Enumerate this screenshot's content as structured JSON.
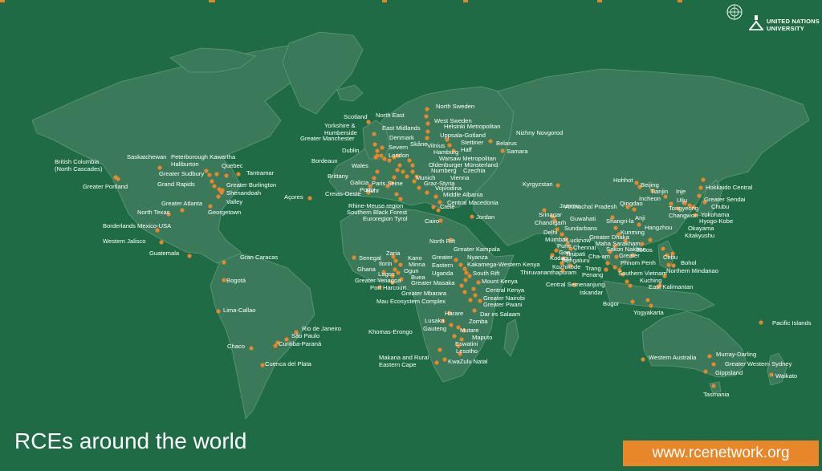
{
  "title": "RCEs around the world",
  "website": "www.rcenetwork.org",
  "logo": {
    "icon": "un-emblem-icon",
    "line1": "UNITED NATIONS",
    "line2": "UNIVERSITY"
  },
  "colors": {
    "background": "#1e6b45",
    "land": "#3a7a5a",
    "marker": "#e8862a",
    "text": "#ffffff"
  },
  "labels": [
    "British Columbia",
    "(North Cascades)",
    "Saskatchewan",
    "Peterborough Kawartha",
    "Haliburton",
    "Quebec",
    "Tantramar",
    "Greater Sudbury",
    "Grand Rapids",
    "Greater Burlington",
    "Shenandoah",
    "Valley",
    "Greater Portland",
    "Greater Atlanta",
    "Georgetown",
    "North Texas",
    "Borderlands Mexico-USA",
    "Western Jalisco",
    "Guatemala",
    "Gran Caracas",
    "Bogotá",
    "Lima-Callao",
    "Rio de Janeiro",
    "São Paulo",
    "Curitiba-Paraná",
    "Chaco",
    "Cuenca del Plata",
    "Açores",
    "Scotland",
    "North East",
    "North Sweden",
    "West Sweden",
    "Helsinki Metropolitan",
    "Uppsala-Gotland",
    "Nizhny Novgorod",
    "Yorkshire &",
    "Humberside",
    "East Midlands",
    "Greater Manchester",
    "Denmark",
    "Skåne",
    "Vilnius",
    "Stettiner",
    "Haff",
    "Belarus",
    "Samara",
    "Dublin",
    "Severn",
    "London",
    "Hamburg",
    "Warsaw Metropolitan",
    "Oldenburger Münsterland",
    "Bordeaux",
    "Wales",
    "Nurnberg",
    "Czechia",
    "Munich",
    "Vienna",
    "Brittany",
    "Galicia",
    "Porto",
    "Creias-Oeste",
    "Paris Seine",
    "Ruhr",
    "Graz-Styria",
    "Vojvodina",
    "Middle Albania",
    "Central Macedonia",
    "Rhine-Meuse region",
    "Southern Black Forest",
    "Euroregion Tyrol",
    "Crete",
    "Cairo",
    "Jordan",
    "Senegal",
    "Zaria",
    "Kano",
    "Minna",
    "Ilorin",
    "Ogun",
    "Lagos",
    "Ghana",
    "Buea",
    "Greater Yenagoa",
    "Port Harcourt",
    "North Rift",
    "Greater Kampala",
    "Nyanza",
    "Greater",
    "Eastern",
    "Uganda",
    "Kakamega-Western Kenya",
    "South Rift",
    "Greater Masaka",
    "Mount Kenya",
    "Central Kenya",
    "Greater Mbarara",
    "Greater Nairobi",
    "Mau Ecosystem Complex",
    "Greater Pwani",
    "Dar es Salaam",
    "Harare",
    "Lusaka",
    "Zomba",
    "Gauteng",
    "Mutare",
    "Khomas-Erongo",
    "Maputo",
    "Eswatini",
    "Lesotho",
    "Makana and Rural",
    "Eastern Cape",
    "KwaZulu Natal",
    "Kyrgyzstan",
    "Jammu",
    "Arunachal Pradesh",
    "Chandigarh",
    "Srinagar",
    "Guwahati",
    "Delhi",
    "Sundarbans",
    "Mumbai",
    "Lucknow",
    "Pune",
    "Chennai",
    "Goa",
    "Tirupati",
    "Kodagu",
    "Bengaluru",
    "Kozhikode",
    "Thiruvananthapuram",
    "Central Semenanjung",
    "Iskandar",
    "Bogor",
    "Yogyakarta",
    "Hohhot",
    "Beijing",
    "Tianjin",
    "Inje",
    "Incheon",
    "Ulju",
    "Qingdao",
    "Tongyeong",
    "Changwon",
    "Hokkaido Central",
    "Greater Sendai",
    "Chubu",
    "Yokohama",
    "Hyogo-Kobe",
    "Okayama",
    "Kitakyushu",
    "Shangri-la",
    "Anji",
    "Hangzhou",
    "Kunming",
    "Greater Dhaka",
    "Maha Sarakham",
    "Sakon Nakhon",
    "Cha-am",
    "Greater",
    "Phnom Penh",
    "Trang",
    "Penang",
    "Southern Vietnam",
    "Kuching",
    "East Kalimantan",
    "Ilocos",
    "Cebu",
    "Bohol",
    "Northern Mindanao",
    "Pacific Islands",
    "Western Australia",
    "Murray-Darling",
    "Greater Western Sydney",
    "Gippsland",
    "Waikato",
    "Tasmania"
  ]
}
